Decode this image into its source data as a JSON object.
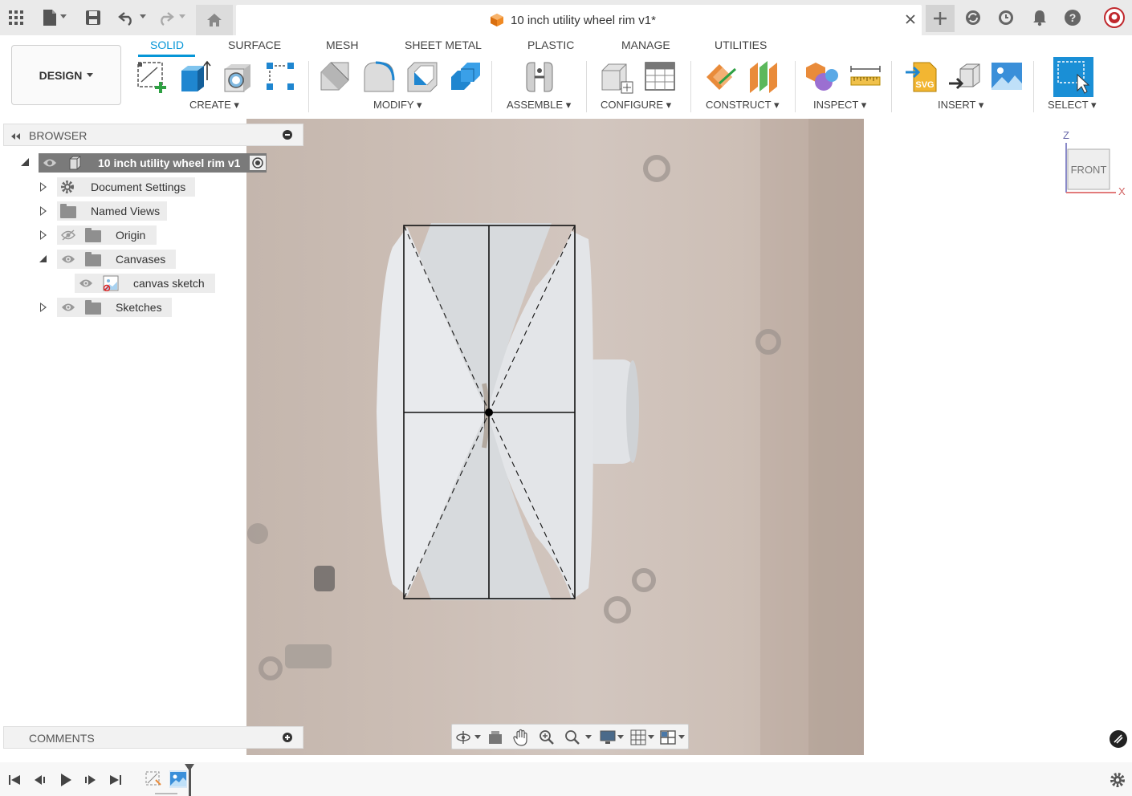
{
  "document": {
    "title": "10 inch utility wheel rim v1*"
  },
  "workspace": {
    "mode_label": "DESIGN"
  },
  "ribbon": {
    "tabs": [
      {
        "label": "SOLID",
        "active": true
      },
      {
        "label": "SURFACE"
      },
      {
        "label": "MESH"
      },
      {
        "label": "SHEET METAL"
      },
      {
        "label": "PLASTIC"
      },
      {
        "label": "MANAGE"
      },
      {
        "label": "UTILITIES"
      }
    ],
    "groups": {
      "create": "CREATE",
      "modify": "MODIFY",
      "assemble": "ASSEMBLE",
      "configure": "CONFIGURE",
      "construct": "CONSTRUCT",
      "inspect": "INSPECT",
      "insert": "INSERT",
      "select": "SELECT"
    }
  },
  "browser": {
    "title": "BROWSER",
    "root": "10 inch utility wheel rim v1",
    "items": [
      {
        "label": "Document Settings"
      },
      {
        "label": "Named Views"
      },
      {
        "label": "Origin"
      },
      {
        "label": "Canvases"
      },
      {
        "label": "canvas sketch"
      },
      {
        "label": "Sketches"
      }
    ]
  },
  "comments": {
    "title": "COMMENTS"
  },
  "viewcube": {
    "face": "FRONT",
    "axis_z": "Z",
    "axis_x": "X"
  },
  "colors": {
    "accent": "#0696d7",
    "select_tool": "#1a8fd6"
  }
}
